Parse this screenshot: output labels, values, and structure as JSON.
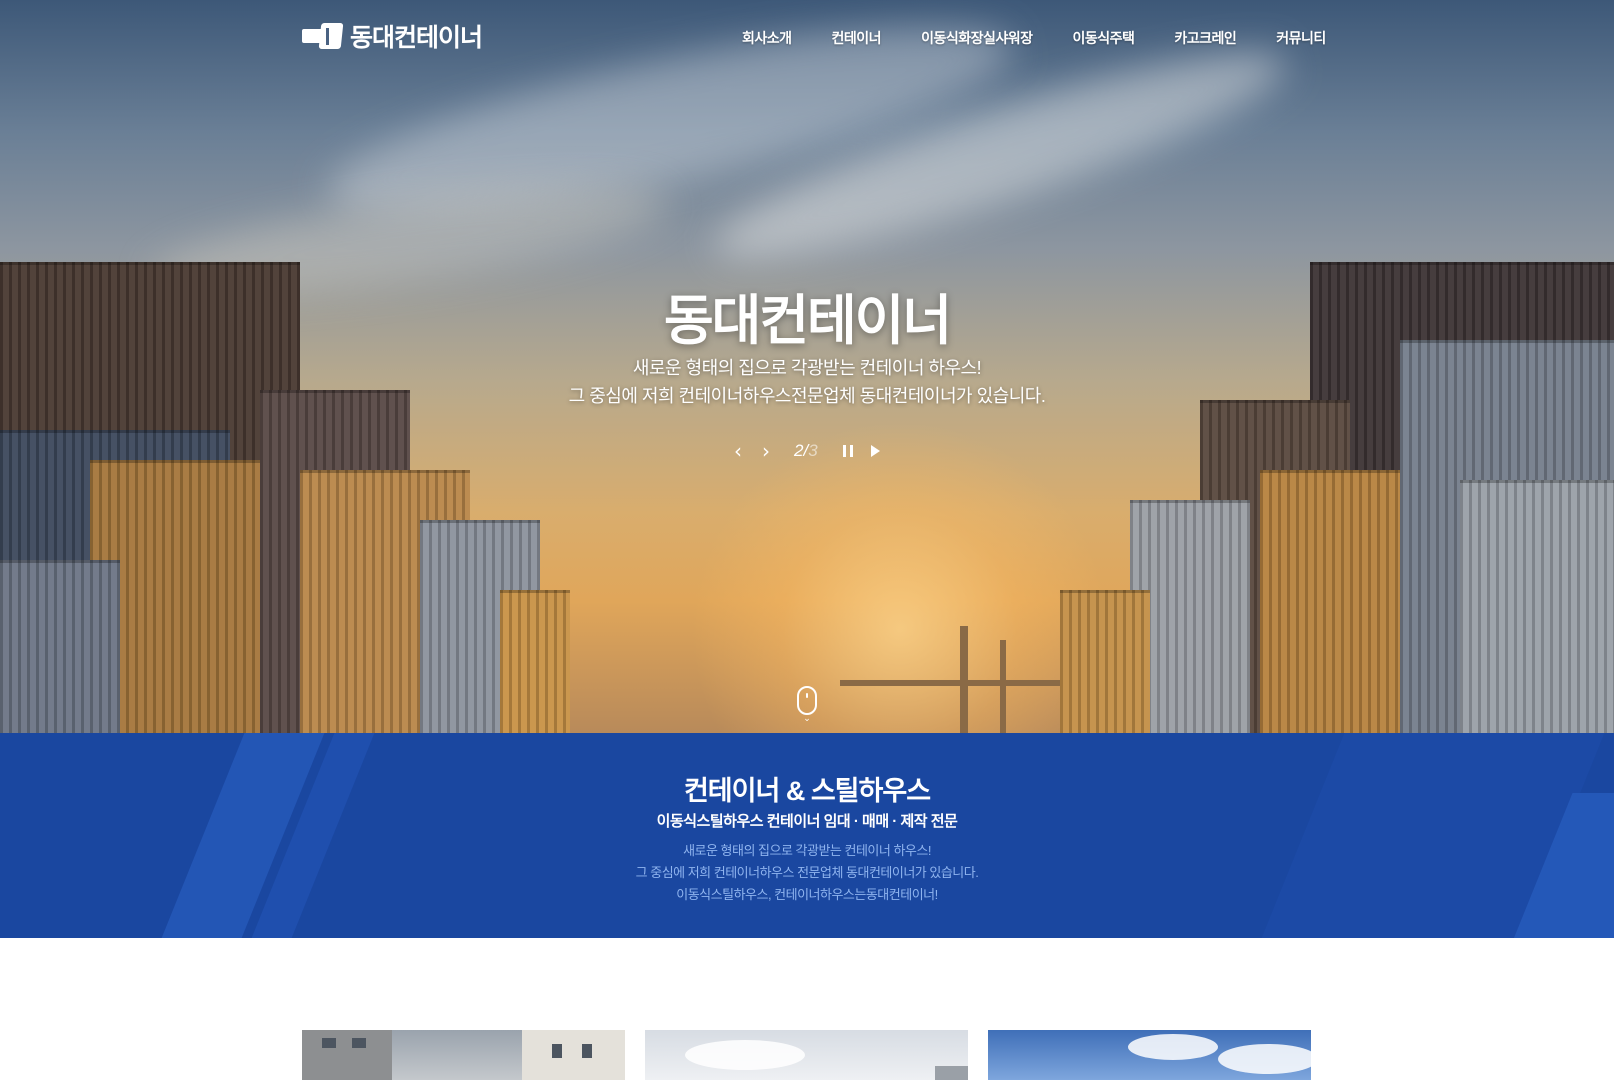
{
  "header": {
    "logo_text": "동대컨테이너",
    "nav": [
      "회사소개",
      "컨테이너",
      "이동식화장실샤워장",
      "이동식주택",
      "카고크레인",
      "커뮤니티"
    ]
  },
  "hero": {
    "title": "동대컨테이너",
    "subtitle_line1": "새로운 형태의 집으로 각광받는 컨테이너 하우스!",
    "subtitle_line2": "그 중심에 저희 컨테이너하우스전문업체 동대컨테이너가 있습니다.",
    "slider": {
      "prev_icon": "‹",
      "next_icon": "›",
      "current": "2",
      "separator": "/",
      "total": "3"
    }
  },
  "band": {
    "title": "컨테이너 & 스틸하우스",
    "subtitle": "이동식스틸하우스 컨테이너 임대 · 매매 · 제작 전문",
    "desc_line1": "새로운 형태의 집으로 각광받는 컨테이너 하우스!",
    "desc_line2": "그 중심에 저희 컨테이너하우스 전문업체 동대컨테이너가 있습니다.",
    "desc_line3": "이동식스틸하우스, 컨테이너하우스는동대컨테이너!"
  },
  "colors": {
    "band_bg": "#1a47a0",
    "band_desc": "#8fb4ef"
  }
}
